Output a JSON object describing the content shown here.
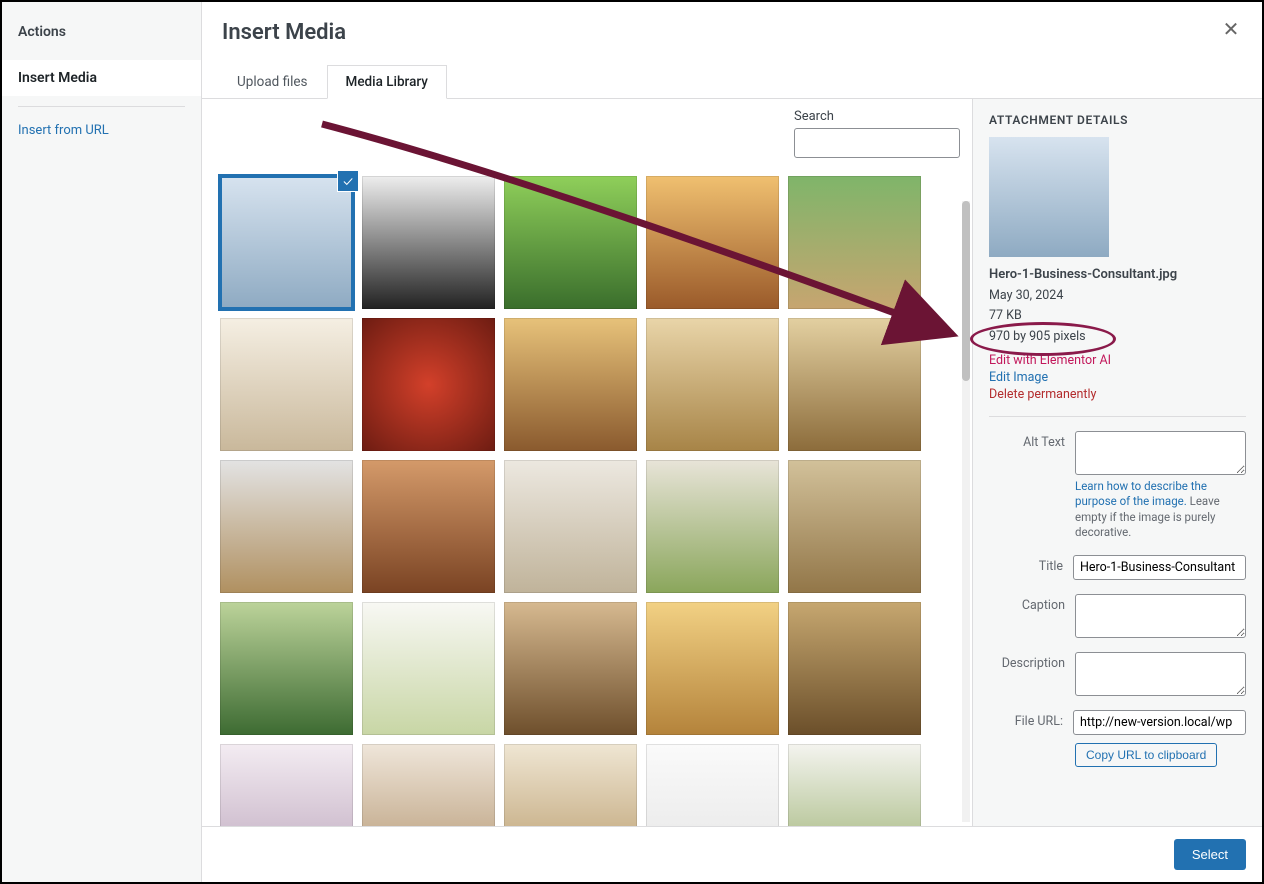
{
  "sidebar": {
    "heading": "Actions",
    "selected": "Insert Media",
    "link_url": "Insert from URL"
  },
  "header": {
    "title": "Insert Media",
    "close_glyph": "✕"
  },
  "tabs": {
    "upload": "Upload files",
    "library": "Media Library"
  },
  "search": {
    "label": "Search",
    "value": ""
  },
  "gallery": {
    "thumbnails_count": 25,
    "selected_index": 0,
    "check_glyph": "✓"
  },
  "details": {
    "heading": "ATTACHMENT DETAILS",
    "filename": "Hero-1-Business-Consultant.jpg",
    "date": "May 30, 2024",
    "filesize": "77 KB",
    "dimensions": "970 by 905 pixels",
    "edit_ai": "Edit with Elementor AI",
    "edit_image": "Edit Image",
    "delete": "Delete permanently",
    "fields": {
      "alt_label": "Alt Text",
      "alt_value": "",
      "alt_help_link": "Learn how to describe the purpose of the image.",
      "alt_help_rest": " Leave empty if the image is purely decorative.",
      "title_label": "Title",
      "title_value": "Hero-1-Business-Consultant",
      "caption_label": "Caption",
      "caption_value": "",
      "desc_label": "Description",
      "desc_value": "",
      "url_label": "File URL:",
      "url_value": "http://new-version.local/wp",
      "copy_label": "Copy URL to clipboard"
    }
  },
  "footer": {
    "select": "Select"
  }
}
